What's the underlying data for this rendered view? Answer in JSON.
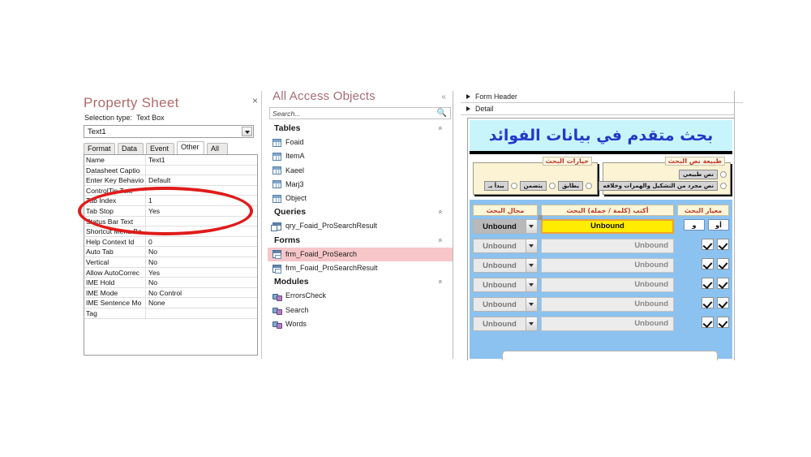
{
  "property_sheet": {
    "title": "Property Sheet",
    "close_label": "×",
    "selection_type_label": "Selection type:",
    "selection_type_value": "Text Box",
    "combo_value": "Text1",
    "tabs": [
      {
        "label": "Format",
        "active": false
      },
      {
        "label": "Data",
        "active": false
      },
      {
        "label": "Event",
        "active": false
      },
      {
        "label": "Other",
        "active": true
      },
      {
        "label": "All",
        "active": false
      }
    ],
    "rows": [
      {
        "name": "Name",
        "value": "Text1"
      },
      {
        "name": "Datasheet Captio",
        "value": ""
      },
      {
        "name": "Enter Key Behavio",
        "value": "Default"
      },
      {
        "name": "ControlTip Text",
        "value": ""
      },
      {
        "name": "Tab Index",
        "value": "1"
      },
      {
        "name": "Tab Stop",
        "value": "Yes"
      },
      {
        "name": "Status Bar Text",
        "value": ""
      },
      {
        "name": "Shortcut Menu Ba",
        "value": ""
      },
      {
        "name": "Help Context Id",
        "value": "0"
      },
      {
        "name": "Auto Tab",
        "value": "No"
      },
      {
        "name": "Vertical",
        "value": "No"
      },
      {
        "name": "Allow AutoCorrec",
        "value": "Yes"
      },
      {
        "name": "IME Hold",
        "value": "No"
      },
      {
        "name": "IME Mode",
        "value": "No Control"
      },
      {
        "name": "IME Sentence Mo",
        "value": "None"
      },
      {
        "name": "Tag",
        "value": ""
      }
    ],
    "annotation_color": "#e01b1b"
  },
  "nav_pane": {
    "title": "All Access Objects",
    "search_placeholder": "Search...",
    "search_value": "",
    "collapse_glyph": "«",
    "groups": [
      {
        "label": "Tables",
        "icon": "table-icon",
        "items": [
          {
            "label": "Foaid",
            "selected": false
          },
          {
            "label": "ItemA",
            "selected": false
          },
          {
            "label": "Kaeel",
            "selected": false
          },
          {
            "label": "Marj3",
            "selected": false
          },
          {
            "label": "Object",
            "selected": false
          }
        ]
      },
      {
        "label": "Queries",
        "icon": "query-icon",
        "items": [
          {
            "label": "qry_Foaid_ProSearchResult",
            "selected": false
          }
        ]
      },
      {
        "label": "Forms",
        "icon": "form-icon",
        "items": [
          {
            "label": "frm_Foaid_ProSearch",
            "selected": true
          },
          {
            "label": "frm_Foaid_ProSearchResult",
            "selected": false
          }
        ]
      },
      {
        "label": "Modules",
        "icon": "module-icon",
        "items": [
          {
            "label": "ErrorsCheck",
            "selected": false
          },
          {
            "label": "Search",
            "selected": false
          },
          {
            "label": "Words",
            "selected": false
          }
        ]
      }
    ]
  },
  "form_designer": {
    "bands": [
      {
        "label": "Form Header"
      },
      {
        "label": "Detail"
      }
    ],
    "form_title": "بحث متقدم في بيانات الفوائد",
    "search_options": {
      "legend": "خيارات البحث",
      "options": [
        {
          "label": "يطابق",
          "selected": false
        },
        {
          "label": "يتضمن",
          "selected": false
        },
        {
          "label": "يبدأ بـ",
          "selected": false
        }
      ]
    },
    "text_type": {
      "legend": "طبيعة نص البحث",
      "options": [
        {
          "label": "نص طبيعي",
          "selected": false
        },
        {
          "label": "نص مجرد من التشكيل والهمزات وخلافه",
          "selected": false
        }
      ]
    },
    "columns": [
      {
        "key": "criteria",
        "label": "معيار البحث"
      },
      {
        "key": "keyword",
        "label": "أكتب (كلمة / جملة) البحث"
      },
      {
        "key": "field",
        "label": "مجال البحث"
      }
    ],
    "rows": [
      {
        "field": "Unbound",
        "keyword": "Unbound",
        "criteria_type": "andor",
        "and_label": "و",
        "or_label": "أو",
        "active": true
      },
      {
        "field": "Unbound",
        "keyword": "Unbound",
        "criteria_type": "checks",
        "active": false
      },
      {
        "field": "Unbound",
        "keyword": "Unbound",
        "criteria_type": "checks",
        "active": false
      },
      {
        "field": "Unbound",
        "keyword": "Unbound",
        "criteria_type": "checks",
        "active": false
      },
      {
        "field": "Unbound",
        "keyword": "Unbound",
        "criteria_type": "checks",
        "active": false
      },
      {
        "field": "Unbound",
        "keyword": "Unbound",
        "criteria_type": "checks",
        "active": false
      }
    ],
    "colors": {
      "title_bg": "#c8f5fb",
      "title_text": "#2438c8",
      "panel_bg": "#8cc2ef",
      "label_bg": "#fdf6d8",
      "label_text": "#c0392b",
      "active_field_bg": "#ffec00"
    }
  }
}
